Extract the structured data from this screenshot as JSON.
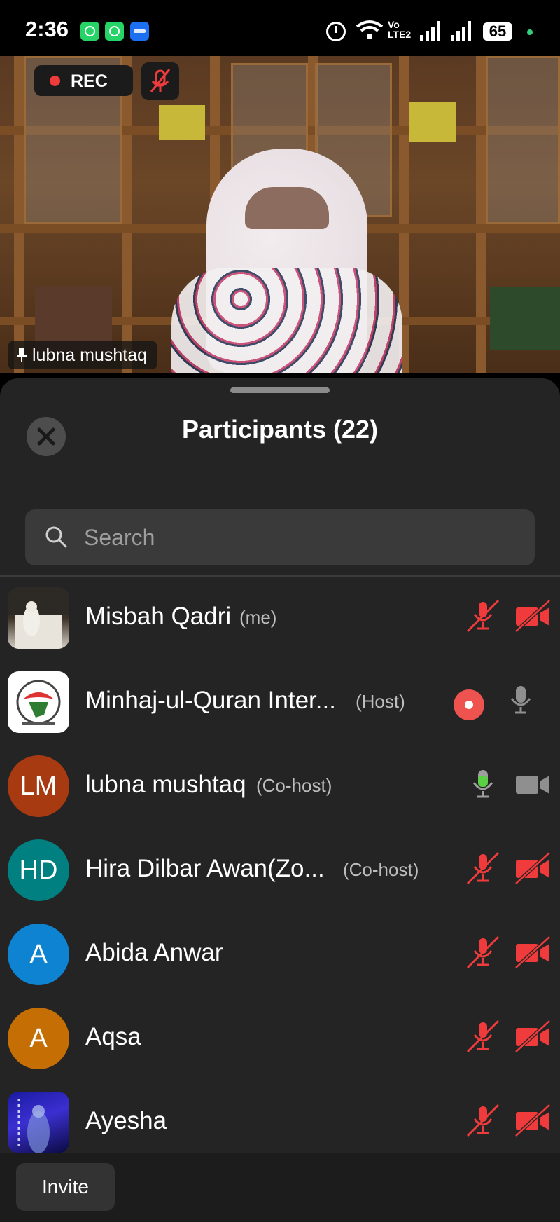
{
  "status_bar": {
    "time": "2:36",
    "notifications": [
      "whatsapp-icon",
      "whatsapp-icon",
      "zoom-icon"
    ],
    "network_label": "Vo LTE2",
    "battery": "65"
  },
  "video": {
    "rec_label": "REC",
    "speaker_name": "lubna mushtaq"
  },
  "participants_panel": {
    "title": "Participants (22)",
    "search_placeholder": "Search",
    "participants": [
      {
        "name": "Misbah Qadri",
        "role": "(me)",
        "avatar": "photo",
        "mic": "muted",
        "video": "off"
      },
      {
        "name": "Minhaj-ul-Quran Inter...",
        "role": "(Host)",
        "avatar": "logo",
        "recording": true,
        "mic": "on"
      },
      {
        "name": "lubna mushtaq",
        "role": "(Co-host)",
        "avatar_initials": "LM",
        "avatar_color": "#a83a12",
        "mic": "active",
        "video": "on"
      },
      {
        "name": "Hira Dilbar Awan(Zo...",
        "role": "(Co-host)",
        "avatar_initials": "HD",
        "avatar_color": "#008080",
        "mic": "muted",
        "video": "off"
      },
      {
        "name": "Abida Anwar",
        "role": "",
        "avatar_initials": "A",
        "avatar_color": "#0e83d2",
        "mic": "muted",
        "video": "off"
      },
      {
        "name": "Aqsa",
        "role": "",
        "avatar_initials": "A",
        "avatar_color": "#c46e04",
        "mic": "muted",
        "video": "off"
      },
      {
        "name": "Ayesha",
        "role": "",
        "avatar": "photo",
        "mic": "muted",
        "video": "off"
      }
    ]
  },
  "bottom_bar": {
    "invite_label": "Invite"
  },
  "colors": {
    "muted_red": "#ef3b3b",
    "active_green": "#5ad142",
    "panel_bg": "#242424"
  }
}
